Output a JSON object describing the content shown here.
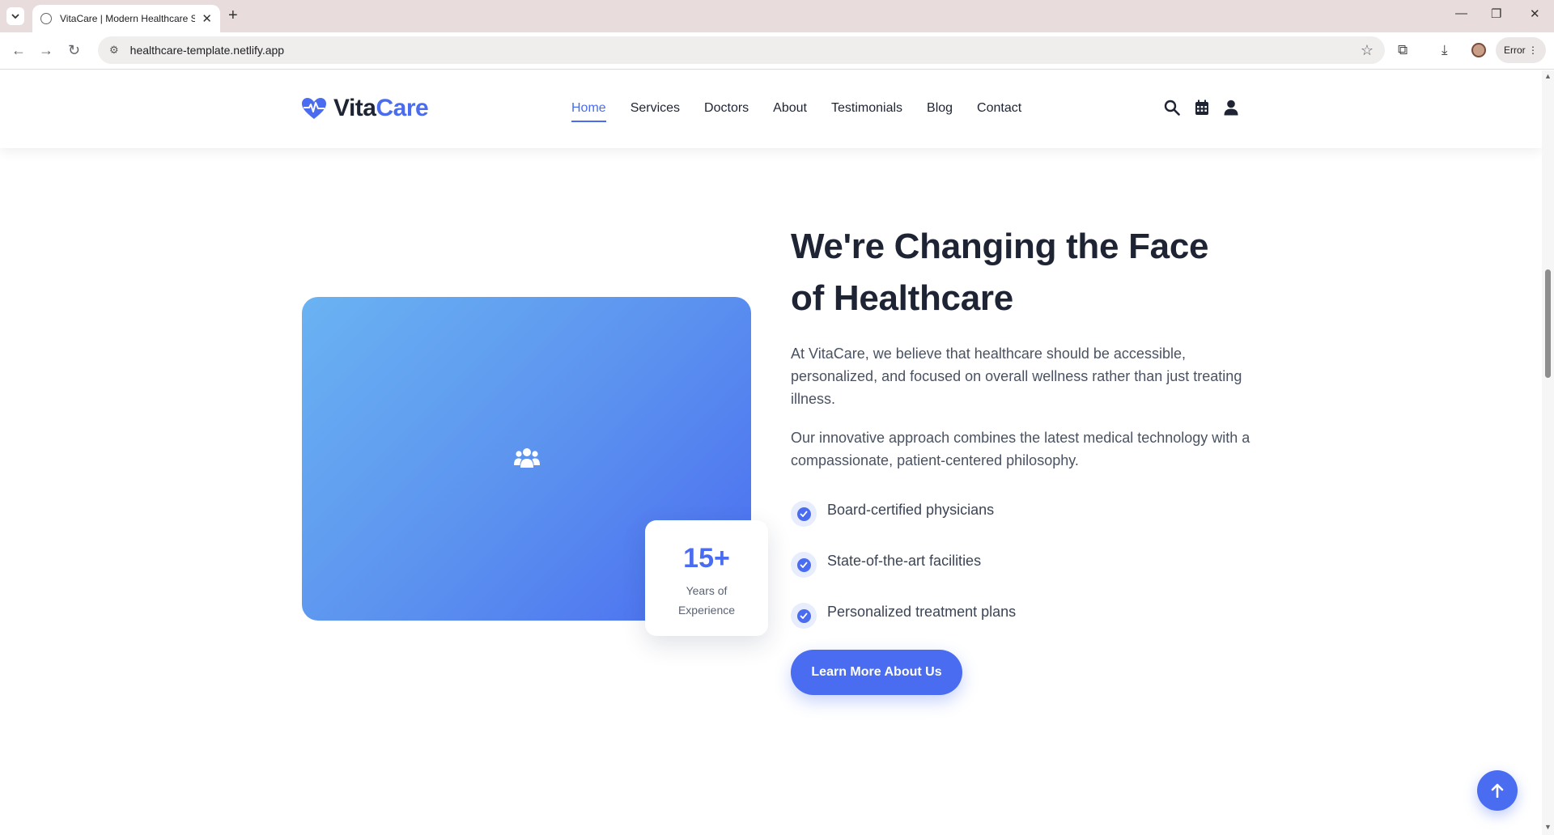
{
  "browser": {
    "tab_title": "VitaCare | Modern Healthcare S",
    "url": "healthcare-template.netlify.app",
    "profile_status": "Error"
  },
  "site": {
    "logo_part1": "Vita",
    "logo_part2": "Care",
    "nav": [
      {
        "label": "Home",
        "active": true
      },
      {
        "label": "Services"
      },
      {
        "label": "Doctors"
      },
      {
        "label": "About"
      },
      {
        "label": "Testimonials"
      },
      {
        "label": "Blog"
      },
      {
        "label": "Contact"
      }
    ],
    "header_icons": [
      "search-icon",
      "calendar-icon",
      "user-icon"
    ]
  },
  "about": {
    "title_line1": "We're Changing the Face",
    "title_line2": "of Healthcare",
    "paragraph1": "At VitaCare, we believe that healthcare should be accessible, personalized, and focused on overall wellness rather than just treating illness.",
    "paragraph2": "Our innovative approach combines the latest medical technology with a compassionate, patient-centered philosophy.",
    "features": [
      "Board-certified physicians",
      "State-of-the-art facilities",
      "Personalized treatment plans"
    ],
    "cta_label": "Learn More About Us",
    "experience_value": "15+",
    "experience_label": "Years of Experience",
    "image_icon": "users-icon"
  },
  "colors": {
    "accent": "#4a6cf0",
    "heading": "#1e2433",
    "body_text": "#4a5262"
  }
}
